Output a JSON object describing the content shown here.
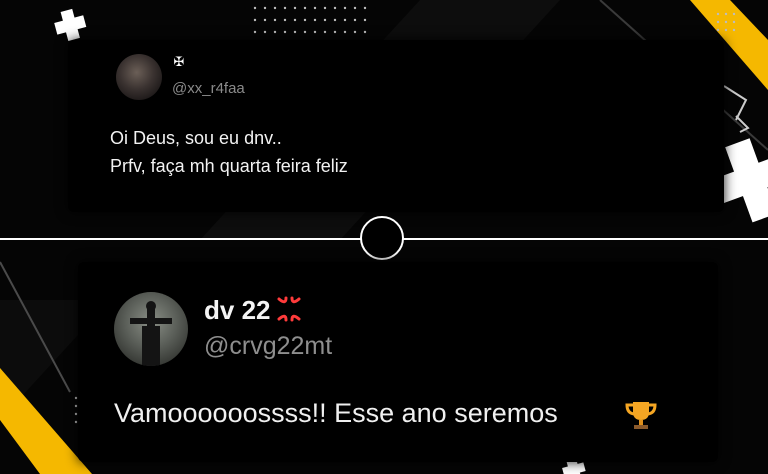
{
  "post_top": {
    "badge_icon": "cross-emblem-icon",
    "handle": "@xx_r4faa",
    "lines": [
      "Oi Deus, sou eu dnv..",
      "Prfv, faça mh quarta feira feliz"
    ]
  },
  "post_bottom": {
    "name": "dv 22",
    "name_icon": "anger-symbol-icon",
    "handle": "@crvg22mt",
    "text": "Vamoooooossss!! Esse ano seremos",
    "text_icon": "trophy-icon"
  },
  "colors": {
    "accent_yellow": "#F5B800",
    "background": "#050505",
    "card": "#000000",
    "text": "#F2F2F2",
    "handle": "#8A8A8A"
  }
}
